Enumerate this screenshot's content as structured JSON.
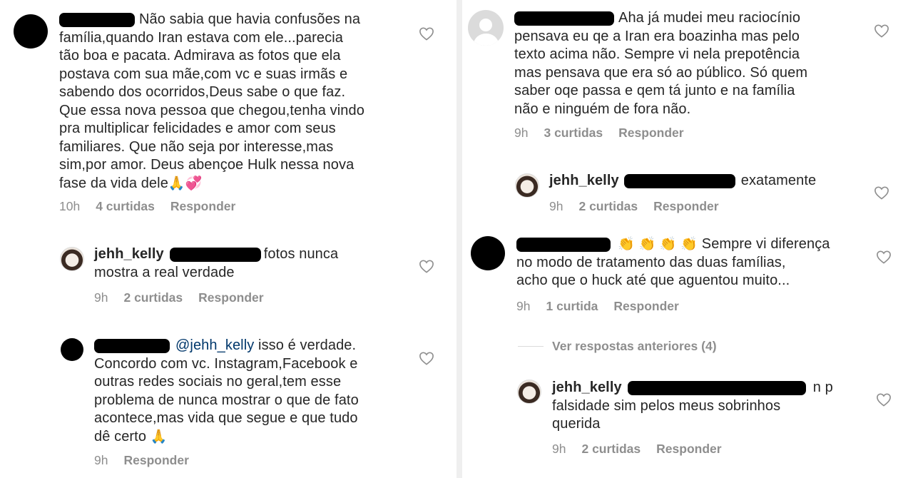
{
  "comments": [
    {
      "text": "Não sabia que havia confusões na família,quando Iran estava com ele...parecia tão boa e pacata. Admirava as fotos que ela postava com sua mãe,com vc e suas irmãs e sabendo dos ocorridos,Deus sabe o que faz. Que essa nova pessoa que chegou,tenha vindo pra multiplicar felicidades e amor com seus familiares. Que não seja por interesse,mas sim,por amor. Deus abençoe Hulk nessa nova fase da vida dele",
      "lines": [
        "Não sabia que havia confusões na",
        "família,quando Iran estava com ele...parecia",
        "tão boa e pacata. Admirava as fotos que ela",
        "postava com sua mãe,com vc e suas irmãs e",
        "sabendo dos ocorridos,Deus sabe o que faz.",
        "Que essa nova pessoa que chegou,tenha vindo",
        "pra multiplicar felicidades e amor com seus",
        "familiares. Que não seja por interesse,mas",
        "sim,por amor. Deus abençoe Hulk nessa nova",
        "fase da vida dele"
      ],
      "emoji": [
        "🙏",
        "💞"
      ],
      "time": "10h",
      "likes": "4 curtidas",
      "reply": "Responder"
    },
    {
      "username": "jehh_kelly",
      "lines": [
        "fotos nunca",
        "mostra a real verdade"
      ],
      "time": "9h",
      "likes": "2 curtidas",
      "reply": "Responder"
    },
    {
      "mention": "@jehh_kelly",
      "lines": [
        "isso é verdade.",
        "Concordo com vc. Instagram,Facebook e",
        "outras redes sociais no geral,tem esse",
        "problema de nunca mostrar o que de fato",
        "acontece,mas vida que segue e que tudo",
        "dê certo"
      ],
      "emoji": [
        "🙏"
      ],
      "time": "9h",
      "reply": "Responder"
    },
    {
      "lines": [
        "Aha já mudei meu raciocínio",
        "pensava eu qe a Iran era boazinha mas pelo",
        "texto acima não. Sempre vi nela prepotência",
        "mas pensava que era só ao público. Só quem",
        "saber oqe passa e qem tá junto e na família",
        "não e ninguém de fora não."
      ],
      "time": "9h",
      "likes": "3 curtidas",
      "reply": "Responder"
    },
    {
      "username": "jehh_kelly",
      "lines": [
        "exatamente"
      ],
      "time": "9h",
      "likes": "2 curtidas",
      "reply": "Responder"
    },
    {
      "emoji": [
        "👏",
        "👏",
        "👏",
        "👏"
      ],
      "lines": [
        "Sempre vi diferença",
        "no modo  de tratamento das duas famílias,",
        "acho que o huck até que aguentou muito..."
      ],
      "time": "9h",
      "likes": "1 curtida",
      "reply": "Responder"
    },
    {
      "username": "jehh_kelly",
      "lines": [
        "n p",
        "falsidade sim pelos meus sobrinhos",
        "querida"
      ],
      "time": "9h",
      "likes": "2 curtidas",
      "reply": "Responder"
    }
  ],
  "view_previous": "Ver respostas anteriores (4)",
  "colors": {
    "text": "#262626",
    "meta": "#8e8e8e",
    "mention": "#00376b",
    "divider": "#efefef"
  },
  "icons": {
    "like": "heart-outline-icon"
  }
}
